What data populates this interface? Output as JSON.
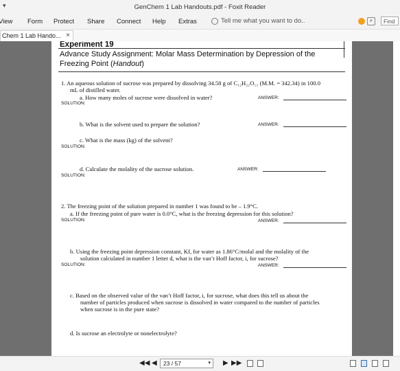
{
  "window": {
    "qa_glyph": "▾",
    "title": "GenChem 1 Lab Handouts.pdf - Foxit Reader"
  },
  "menu": {
    "items": [
      "View",
      "Form",
      "Protect",
      "Share",
      "Connect",
      "Help",
      "Extras"
    ],
    "tell_me_placeholder": "Tell me what you want to do..",
    "find_label": "Find"
  },
  "tab": {
    "label": "Chem 1 Lab Hando...",
    "close": "×"
  },
  "doc": {
    "experiment": "Experiment 19",
    "header_line1": "Advance Study Assignment:  Molar Mass Determination by Depression of the",
    "header_line2_a": "Freezing Point (",
    "header_line2_b": "Handout",
    "header_line2_c": ")",
    "q1_line1": "1.  An aqueous solution of sucrose was prepared by dissolving 34.58 g of C₁₂H₂₂O₁₁ (M.M. = 342.34) in 100.0",
    "q1_line2": "mL of distilled water.",
    "q1a": "a.  How many moles of sucrose were dissolved in water?",
    "q1b": "b.  What is the solvent used to prepare the solution?",
    "q1c": "c.  What is the mass (kg) of the solvent?",
    "q1d": "d.  Calculate the molality of the sucrose solution.",
    "q2_line1": "2.  The freezing point of the solution prepared in number 1 was found to be – 1.9°C.",
    "q2a": "a.  If the freezing point of pure water is 0.0°C, what is the freezing depression for this solution?",
    "q2b_line1": "b.  Using the freezing point depression constant, Kf, for water as 1.86°C/molal and the molality of the",
    "q2b_line2": "solution calculated in number 1 letter d, what is the van’t Hoff factor, i, for sucrose?",
    "q2c_line1": "c.  Based on the observed value of the van’t Hoff factor, i, for sucrose, what does this tell us about the",
    "q2c_line2": "number of particles produced when sucrose is dissolved in water compared to the number of particles",
    "q2c_line3": "when sucrose is in the pure state?",
    "q2d": "d.  Is sucrose an electrolyte or nonelectrolyte?",
    "solution_label": "SOLUTION:",
    "answer_label": "ANSWER:"
  },
  "status": {
    "first": "◀◀",
    "prev": "◀",
    "page_text": "23 / 57",
    "dropdown": "▾",
    "next": "▶",
    "last": "▶▶"
  }
}
